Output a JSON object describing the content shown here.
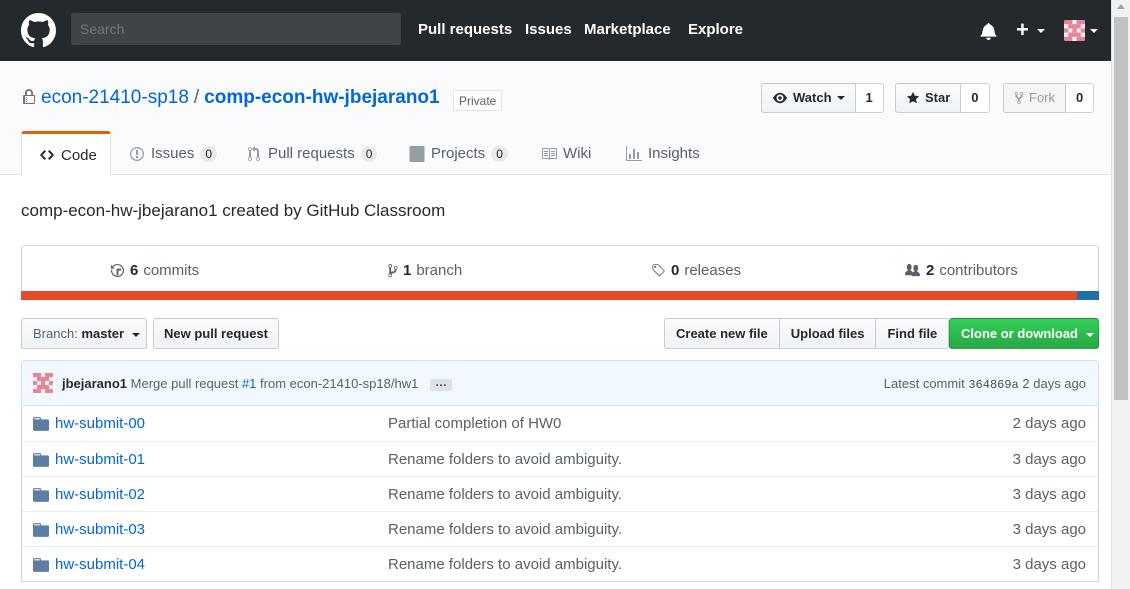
{
  "header": {
    "search_placeholder": "Search",
    "nav": [
      "Pull requests",
      "Issues",
      "Marketplace",
      "Explore"
    ]
  },
  "repo": {
    "owner": "econ-21410-sp18",
    "separator": "/",
    "name": "comp-econ-hw-jbejarano1",
    "visibility": "Private",
    "watch_label": "Watch",
    "watch_count": "1",
    "star_label": "Star",
    "star_count": "0",
    "fork_label": "Fork",
    "fork_count": "0"
  },
  "tabs": [
    {
      "label": "Code",
      "counter": ""
    },
    {
      "label": "Issues",
      "counter": "0"
    },
    {
      "label": "Pull requests",
      "counter": "0"
    },
    {
      "label": "Projects",
      "counter": "0"
    },
    {
      "label": "Wiki",
      "counter": ""
    },
    {
      "label": "Insights",
      "counter": ""
    }
  ],
  "description": "comp-econ-hw-jbejarano1 created by GitHub Classroom",
  "summary": {
    "commits_num": "6",
    "commits_label": "commits",
    "branch_num": "1",
    "branch_label": "branch",
    "releases_num": "0",
    "releases_label": "releases",
    "contributors_num": "2",
    "contributors_label": "contributors"
  },
  "languages": {
    "colors": [
      "#e34c26",
      "#1f6fa8"
    ]
  },
  "file_nav": {
    "branch_prefix": "Branch:",
    "branch_name": "master",
    "new_pr": "New pull request",
    "create_file": "Create new file",
    "upload_files": "Upload files",
    "find_file": "Find file",
    "clone": "Clone or download"
  },
  "commit": {
    "author": "jbejarano1",
    "message_prefix": "Merge pull request",
    "pr_link": "#1",
    "message_suffix": "from econ-21410-sp18/hw1",
    "ellipsis": "…",
    "latest_label": "Latest commit",
    "sha": "364869a",
    "age": "2 days ago"
  },
  "files": [
    {
      "name": "hw-submit-00",
      "message": "Partial completion of HW0",
      "age": "2 days ago"
    },
    {
      "name": "hw-submit-01",
      "message": "Rename folders to avoid ambiguity.",
      "age": "3 days ago"
    },
    {
      "name": "hw-submit-02",
      "message": "Rename folders to avoid ambiguity.",
      "age": "3 days ago"
    },
    {
      "name": "hw-submit-03",
      "message": "Rename folders to avoid ambiguity.",
      "age": "3 days ago"
    },
    {
      "name": "hw-submit-04",
      "message": "Rename folders to avoid ambiguity.",
      "age": "3 days ago"
    }
  ]
}
